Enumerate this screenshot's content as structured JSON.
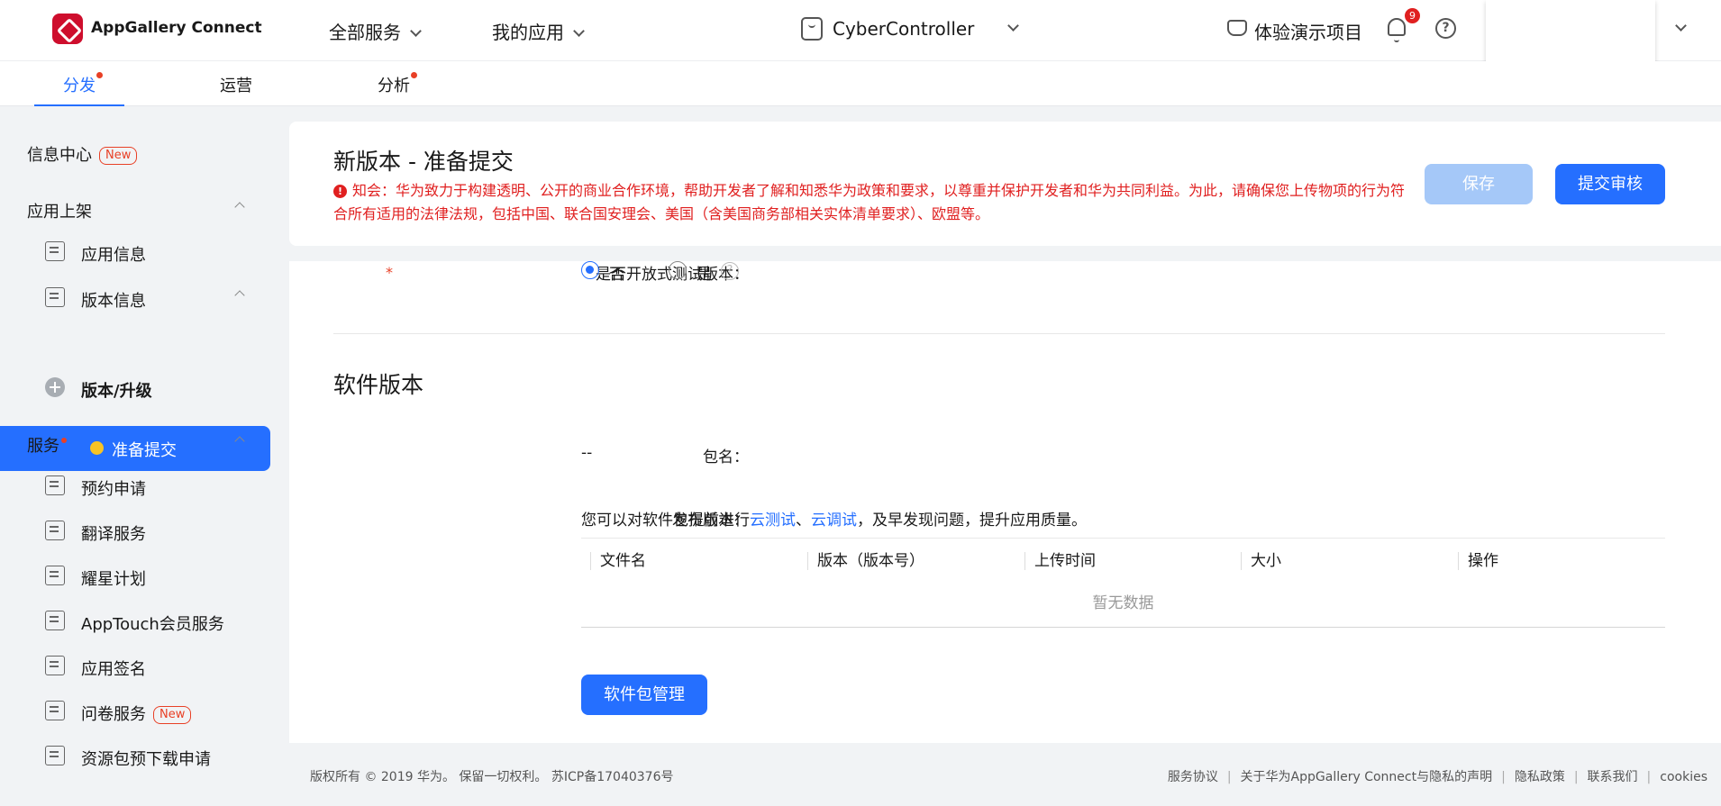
{
  "header": {
    "brand": "AppGallery Connect",
    "nav": [
      {
        "label": "全部服务"
      },
      {
        "label": "我的应用"
      }
    ],
    "app_name": "CyberController",
    "demo_project": "体验演示项目",
    "notification_count": "9",
    "help_symbol": "?"
  },
  "subnav": {
    "tabs": [
      {
        "label": "分发",
        "active": true,
        "dot": true
      },
      {
        "label": "运营",
        "active": false,
        "dot": false
      },
      {
        "label": "分析",
        "active": false,
        "dot": true
      }
    ]
  },
  "sidebar": {
    "info_center": "信息中心",
    "new_tag": "New",
    "group_listing": "应用上架",
    "app_info": "应用信息",
    "version_info": "版本信息",
    "prepare_submit": "准备提交",
    "version_upgrade": "版本/升级",
    "group_services": "服务",
    "items": [
      {
        "label": "预约申请",
        "icon": "calendar-doc-icon"
      },
      {
        "label": "翻译服务",
        "icon": "translate-icon"
      },
      {
        "label": "耀星计划",
        "icon": "star-badge-icon"
      },
      {
        "label": "AppTouch会员服务",
        "icon": "member-icon"
      },
      {
        "label": "应用签名",
        "icon": "signature-icon"
      },
      {
        "label": "问卷服务",
        "icon": "survey-icon",
        "new": true
      },
      {
        "label": "资源包预下载申请",
        "icon": "package-icon"
      }
    ]
  },
  "page": {
    "title": "新版本 - 准备提交",
    "notice": "知会：华为致力于构建透明、公开的商业合作环境，帮助开发者了解和知悉华为政策和要求，以尊重并保护开发者和华为共同利益。为此，请确保您上传物项的行为符合所有适用的法律法规，包括中国、联合国安理会、美国（含美国商务部相关实体清单要求）、欧盟等。",
    "save_label": "保存",
    "submit_label": "提交审核"
  },
  "form": {
    "open_test_label": "是否开放式测试版本：",
    "radio_no": "否",
    "radio_yes": "是",
    "selected": "否",
    "section_title": "软件版本",
    "package_label": "包名：",
    "package_value": "--",
    "release_label": "发布版本：",
    "release_text_1": "您可以对软件包提前进行",
    "link_cloud_test": "云测试",
    "sep": "、",
    "link_cloud_debug": "云调试",
    "release_text_2": "，及早发现问题，提升应用质量。",
    "table_columns": [
      "文件名",
      "版本（版本号）",
      "上传时间",
      "大小",
      "操作"
    ],
    "table_empty": "暂无数据",
    "pkg_button": "软件包管理"
  },
  "footer": {
    "copyright": "版权所有 © 2019 华为。 保留一切权利。 苏ICP备17040376号",
    "links": [
      "服务协议",
      "关于华为AppGallery Connect与隐私的声明",
      "隐私政策",
      "联系我们",
      "cookies"
    ]
  },
  "colors": {
    "accent": "#256fff",
    "danger": "#e02020",
    "disabled_button": "#a5c8f8"
  }
}
